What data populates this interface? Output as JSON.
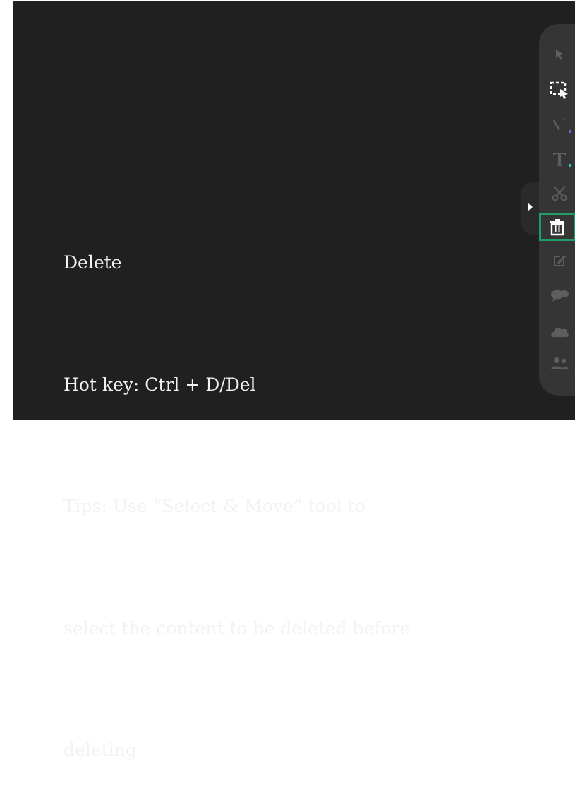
{
  "help": {
    "title": "Delete",
    "hotkey": "Hot key: Ctrl + D/Del",
    "tips_line1": "Tips: Use “Select & Move” tool to",
    "tips_line2": "select the content to be deleted before",
    "tips_line3": "deleting"
  },
  "toolbar": {
    "tools": [
      {
        "name": "pointer",
        "icon": "cursor-arrow-icon",
        "active": false
      },
      {
        "name": "select-and-move",
        "icon": "marquee-select-icon",
        "active": false
      },
      {
        "name": "pen",
        "icon": "pen-icon",
        "active": false,
        "color": "#7b5cd6"
      },
      {
        "name": "text",
        "icon": "text-icon",
        "active": false,
        "color": "#22c1c3"
      },
      {
        "name": "cut",
        "icon": "scissors-icon",
        "active": false
      },
      {
        "name": "delete",
        "icon": "trash-icon",
        "active": true
      },
      {
        "name": "edit",
        "icon": "edit-icon",
        "active": false
      },
      {
        "name": "comment",
        "icon": "chat-bubbles-icon",
        "active": false
      },
      {
        "name": "cloud",
        "icon": "cloud-icon",
        "active": false
      },
      {
        "name": "participants",
        "icon": "users-icon",
        "active": false
      }
    ]
  },
  "colors": {
    "canvas": "#202020",
    "toolbar": "#353535",
    "highlight": "#1f9d66",
    "icon_dim": "#5e5e5e",
    "icon_bright": "#ffffff"
  }
}
